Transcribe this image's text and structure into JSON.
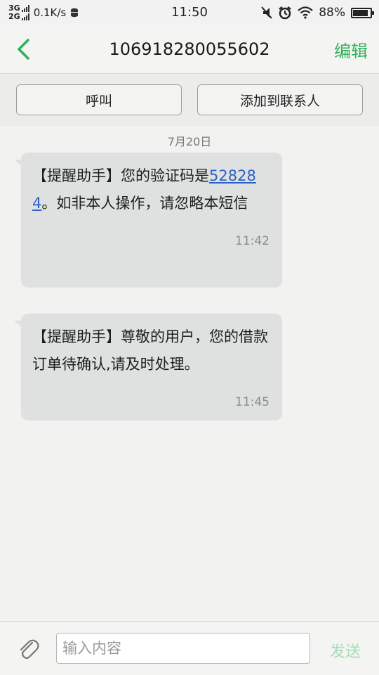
{
  "status_bar": {
    "network_top": "3G",
    "network_bottom": "2G",
    "speed": "0.1K/s",
    "time": "11:50",
    "battery_percent": "88%",
    "battery_level": 0.88,
    "icons": [
      "signal-icon",
      "database-icon",
      "vibrate-mute-icon",
      "alarm-icon",
      "wifi-icon",
      "battery-icon"
    ]
  },
  "header": {
    "title": "106918280055602",
    "edit_label": "编辑",
    "accent_color": "#2fb15a"
  },
  "actions": {
    "call_label": "呼叫",
    "add_contact_label": "添加到联系人"
  },
  "thread": {
    "date": "7月20日",
    "messages": [
      {
        "text_before": "【提醒助手】您的验证码是",
        "code": "528284",
        "text_after": "。如非本人操作，请忽略本短信",
        "time": "11:42"
      },
      {
        "text": "【提醒助手】尊敬的用户，您的借款订单待确认,请及时处理。",
        "time": "11:45"
      }
    ]
  },
  "composer": {
    "placeholder": "输入内容",
    "send_label": "发送"
  }
}
